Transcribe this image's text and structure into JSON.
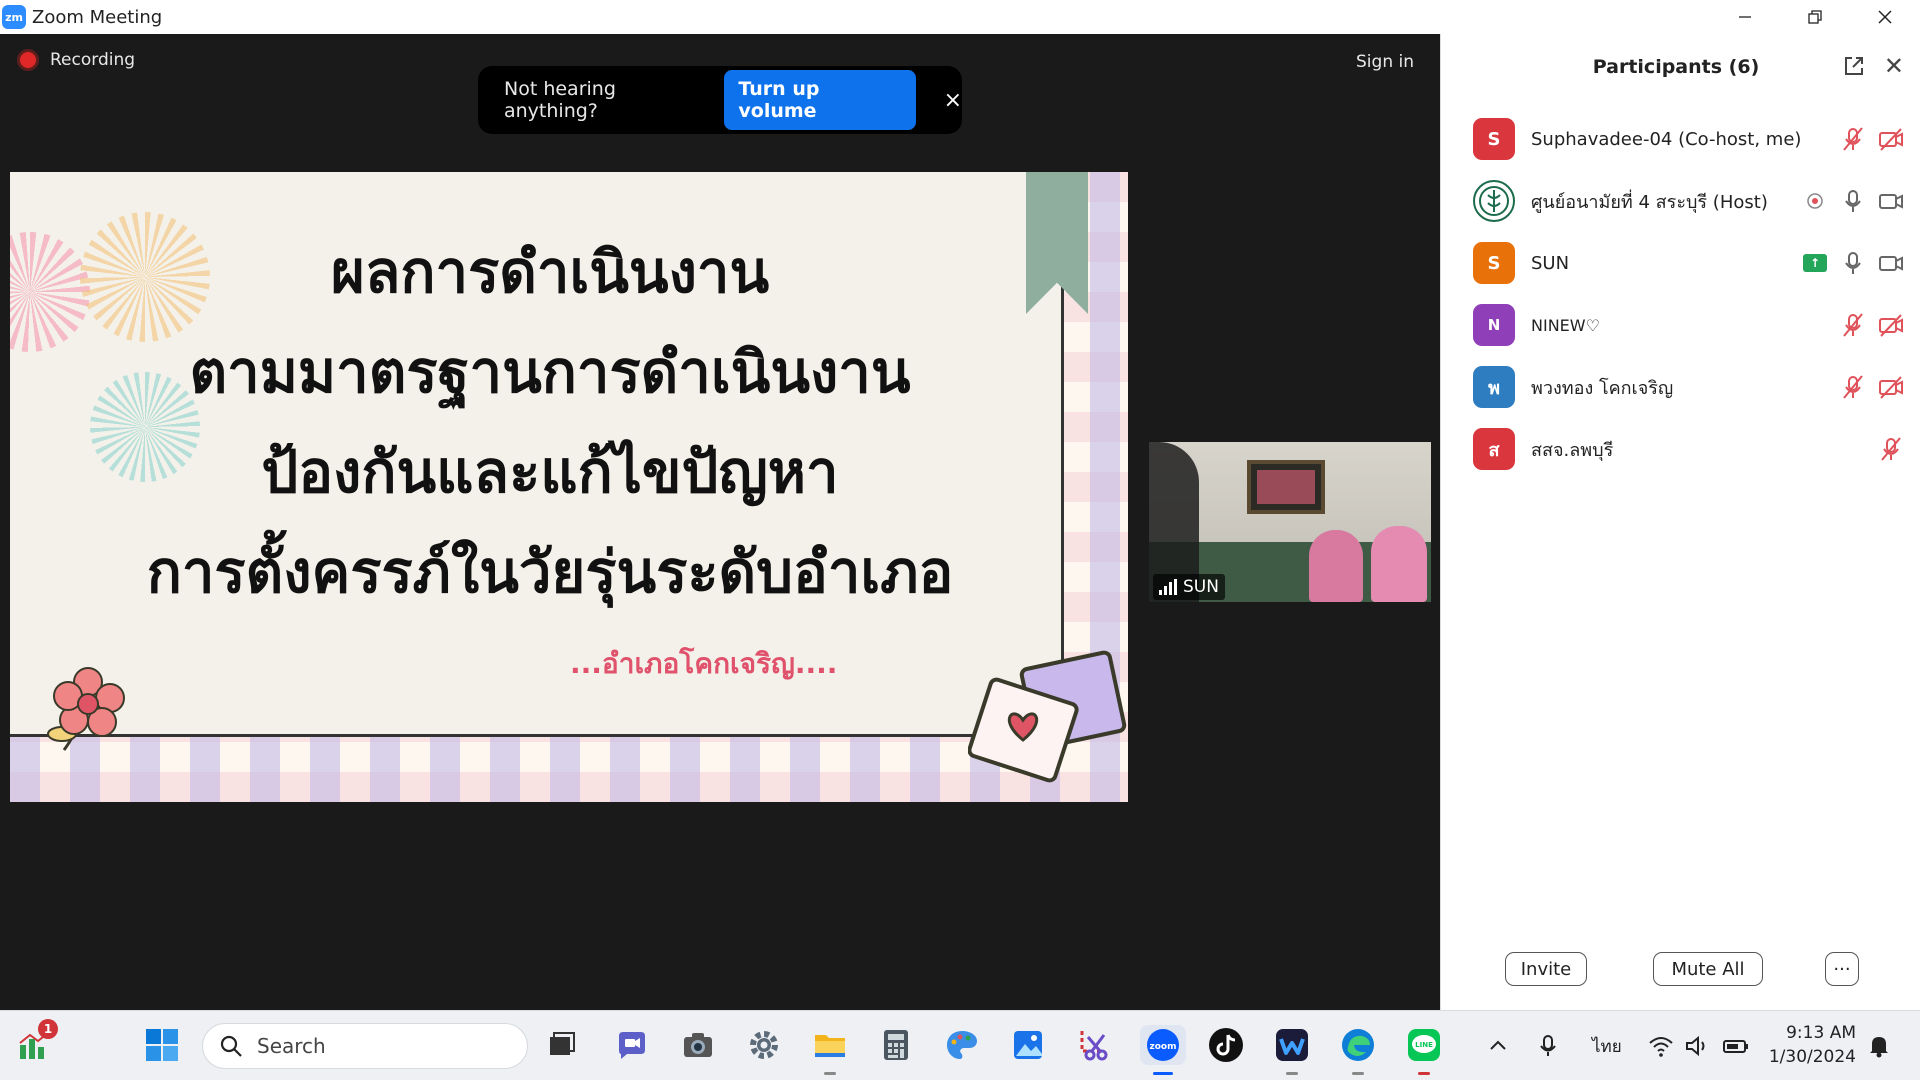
{
  "window": {
    "title": "Zoom Meeting",
    "logo_text": "zm"
  },
  "meeting": {
    "recording_label": "Recording",
    "sign_in_label": "Sign in",
    "toast": {
      "text": "Not hearing anything?",
      "button": "Turn up volume",
      "close": "×"
    }
  },
  "slide": {
    "title_lines": [
      "ผลการดำเนินงาน",
      "ตามมาตรฐานการดำเนินงาน",
      "ป้องกันและแก้ไขปัญหา",
      "การตั้งครรภ์ในวัยรุ่นระดับอำเภอ"
    ],
    "subtitle": "...อำเภอโคกเจริญ...."
  },
  "self_video": {
    "name": "SUN"
  },
  "participants": {
    "title": "Participants (6)",
    "list": [
      {
        "initial": "S",
        "name": "Suphavadee-04 (Co-host, me)",
        "color": "#d9363e"
      },
      {
        "initial": "",
        "name": "ศูนย์อนามัยที่ 4 สระบุรี (Host)",
        "color": "#ffffff"
      },
      {
        "initial": "S",
        "name": "SUN",
        "color": "#e8710a"
      },
      {
        "initial": "N",
        "name": "NINEW♡",
        "color": "#8f3fb7"
      },
      {
        "initial": "พ",
        "name": "พวงทอง โคกเจริญ",
        "color": "#2f7dc1"
      },
      {
        "initial": "ส",
        "name": "สสจ.ลพบุรี",
        "color": "#d9363e"
      }
    ],
    "buttons": {
      "invite": "Invite",
      "mute_all": "Mute All",
      "more": "···"
    }
  },
  "taskbar": {
    "search_placeholder": "Search",
    "notification_badge": "1",
    "language": "ไทย",
    "time": "9:13 AM",
    "date": "1/30/2024"
  }
}
